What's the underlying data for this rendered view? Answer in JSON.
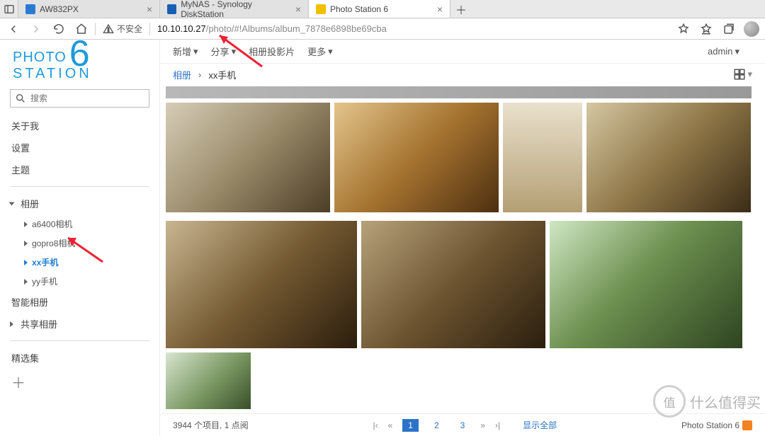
{
  "browser": {
    "tabs": [
      {
        "title": "AW832PX",
        "fav_color": "#2a7ad4"
      },
      {
        "title": "MyNAS - Synology DiskStation",
        "fav_color": "#1b5fb4"
      },
      {
        "title": "Photo Station 6",
        "fav_color": "#f0c000"
      }
    ],
    "active_tab": 2,
    "security_label": "不安全",
    "url_host": "10.10.10.27",
    "url_path": "/photo/#!Albums/album_7878e6898be69cba"
  },
  "logo": {
    "line1": "PHOTO",
    "line2": "STATION",
    "six": "6"
  },
  "search": {
    "placeholder": "搜索"
  },
  "nav": {
    "about": "关于我",
    "settings": "设置",
    "theme": "主题",
    "albums_label": "相册",
    "albums": [
      {
        "label": "a6400相机",
        "selected": false
      },
      {
        "label": "gopro8相机",
        "selected": false
      },
      {
        "label": "xx手机",
        "selected": true
      },
      {
        "label": "yy手机",
        "selected": false
      }
    ],
    "smart_label": "智能相册",
    "shared_label": "共享相册",
    "featured_label": "精选集"
  },
  "toolbar": {
    "add": "新增",
    "share": "分享",
    "slideshow": "相册投影片",
    "more": "更多",
    "user": "admin"
  },
  "breadcrumb": {
    "root": "相册",
    "sep": "›",
    "current": "xx手机"
  },
  "footer": {
    "count_text": "3944 个项目, 1 点阅",
    "pages": [
      "1",
      "2",
      "3"
    ],
    "current_page": "1",
    "show_all": "显示全部",
    "brand": "Photo Station 6"
  },
  "watermark": {
    "char": "值",
    "text": "什么值得买"
  }
}
